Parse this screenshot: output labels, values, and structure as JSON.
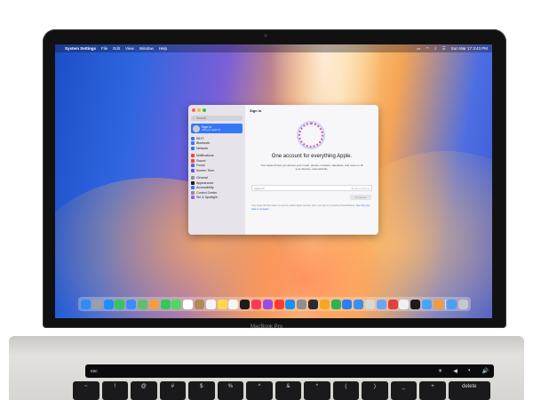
{
  "menubar": {
    "apple_glyph": "",
    "app_name": "System Settings",
    "items": [
      "File",
      "Edit",
      "View",
      "Window",
      "Help"
    ],
    "clock": "Sun Mar 17  3:43 PM"
  },
  "window": {
    "search_placeholder": "Search",
    "signin": {
      "title": "Sign in",
      "subtitle": "with your Apple ID"
    },
    "sidebar_groups": [
      [
        {
          "label": "Wi-Fi",
          "icon": "wifi-icon",
          "color": "#3478f6"
        },
        {
          "label": "Bluetooth",
          "icon": "bluetooth-icon",
          "color": "#3478f6"
        },
        {
          "label": "Network",
          "icon": "network-icon",
          "color": "#3478f6"
        }
      ],
      [
        {
          "label": "Notifications",
          "icon": "bell-icon",
          "color": "#f0453a"
        },
        {
          "label": "Sound",
          "icon": "speaker-icon",
          "color": "#f0453a"
        },
        {
          "label": "Focus",
          "icon": "moon-icon",
          "color": "#5e5ce6"
        },
        {
          "label": "Screen Time",
          "icon": "hourglass-icon",
          "color": "#5e5ce6"
        }
      ],
      [
        {
          "label": "General",
          "icon": "gear-icon",
          "color": "#8e8e93"
        },
        {
          "label": "Appearance",
          "icon": "appearance-icon",
          "color": "#1c1c1e"
        },
        {
          "label": "Accessibility",
          "icon": "accessibility-icon",
          "color": "#3478f6"
        },
        {
          "label": "Control Center",
          "icon": "control-center-icon",
          "color": "#8e8e93"
        },
        {
          "label": "Siri & Spotlight",
          "icon": "siri-icon",
          "color": "#a55bf0"
        }
      ]
    ],
    "main": {
      "title": "Sign in",
      "apple_glyph": "",
      "headline": "One account for everything Apple.",
      "description": "Your Apple ID lets you access your music, photos, contacts, calendars, and more on all your devices, automatically.",
      "field_label": "Apple ID",
      "field_placeholder": "Email or Phone",
      "continue_label": "Continue",
      "fine_print": "Your Apple ID information is used to enable Apple services when you sign in, including iCloud Backup.",
      "fine_link": "See how your data is managed..."
    }
  },
  "dock": {
    "apps": [
      {
        "name": "finder",
        "color": "#2f8cf0"
      },
      {
        "name": "launchpad",
        "color": "#9aa0a8"
      },
      {
        "name": "safari",
        "color": "#1f8ff0"
      },
      {
        "name": "messages",
        "color": "#34c759"
      },
      {
        "name": "mail",
        "color": "#3a8ef6"
      },
      {
        "name": "maps",
        "color": "#5fbf6a"
      },
      {
        "name": "photos",
        "color": "#f2a03a"
      },
      {
        "name": "facetime",
        "color": "#35c759"
      },
      {
        "name": "phone",
        "color": "#4cd964"
      },
      {
        "name": "calendar",
        "color": "#ffffff"
      },
      {
        "name": "contacts",
        "color": "#b08a5a"
      },
      {
        "name": "reminders",
        "color": "#f4f4f4"
      },
      {
        "name": "notes",
        "color": "#ffd94a"
      },
      {
        "name": "freeform",
        "color": "#f5f5f5"
      },
      {
        "name": "tv",
        "color": "#1c1c1e"
      },
      {
        "name": "music",
        "color": "#fa3b58"
      },
      {
        "name": "podcasts",
        "color": "#9b4be4"
      },
      {
        "name": "news",
        "color": "#ff3b30"
      },
      {
        "name": "app-store",
        "color": "#1d8ff2"
      },
      {
        "name": "system-settings",
        "color": "#8e8e93"
      },
      {
        "name": "iphone-mirroring",
        "color": "#2c2c2e"
      },
      {
        "name": "pages",
        "color": "#f5a623"
      },
      {
        "name": "numbers",
        "color": "#2fb350"
      },
      {
        "name": "keynote",
        "color": "#2d7df6"
      },
      {
        "name": "xcode",
        "color": "#3a8ef6"
      },
      {
        "name": "chess",
        "color": "#d8d8d8"
      },
      {
        "name": "preview",
        "color": "#6aa7f0"
      },
      {
        "name": "photo-booth",
        "color": "#e2403a"
      },
      {
        "name": "font-book",
        "color": "#f0f0f0"
      },
      {
        "name": "stocks",
        "color": "#1c1c1e"
      },
      {
        "name": "weather",
        "color": "#4aa3f5"
      },
      {
        "name": "home",
        "color": "#f59b3a"
      }
    ],
    "after_sep": [
      {
        "name": "downloads",
        "color": "#4b9ef0"
      },
      {
        "name": "trash",
        "color": "#c8c8cc"
      }
    ]
  },
  "model_label": "MacBook Pro",
  "touchbar": {
    "esc": "esc",
    "controls": [
      "☀",
      "◀",
      "◐",
      "🔊"
    ]
  },
  "keys": [
    "~",
    "!",
    "@",
    "#",
    "$",
    "%",
    "^",
    "&",
    "*",
    "(",
    ")",
    "_",
    "+",
    "delete"
  ]
}
